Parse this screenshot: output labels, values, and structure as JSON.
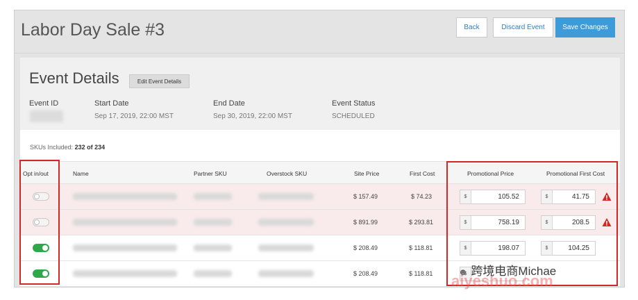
{
  "header": {
    "title": "Labor Day Sale #3",
    "back_label": "Back",
    "discard_label": "Discard Event",
    "save_label": "Save Changes"
  },
  "details": {
    "title": "Event Details",
    "edit_label": "Edit Event Details",
    "event_id_label": "Event ID",
    "start_label": "Start Date",
    "start_value": "Sep 17, 2019, 22:00 MST",
    "end_label": "End Date",
    "end_value": "Sep 30, 2019, 22:00 MST",
    "status_label": "Event Status",
    "status_value": "SCHEDULED"
  },
  "table": {
    "skus_label": "SKUs Included:",
    "skus_value": "232 of 234",
    "columns": [
      "Opt in/out",
      "Name",
      "Partner SKU",
      "Overstock SKU",
      "Site Price",
      "First Cost",
      "Promotional Price",
      "Promotional First Cost"
    ],
    "currency_symbol": "$",
    "rows": [
      {
        "opt_in": false,
        "warning": true,
        "site_price": "$ 157.49",
        "first_cost": "$ 74.23",
        "promo_price": "105.52",
        "promo_first_cost": "41.75"
      },
      {
        "opt_in": false,
        "warning": true,
        "site_price": "$ 891.99",
        "first_cost": "$ 293.81",
        "promo_price": "758.19",
        "promo_first_cost": "208.5"
      },
      {
        "opt_in": true,
        "warning": false,
        "site_price": "$ 208.49",
        "first_cost": "$ 118.81",
        "promo_price": "198.07",
        "promo_first_cost": "104.25"
      },
      {
        "opt_in": true,
        "warning": false,
        "site_price": "$ 208.49",
        "first_cost": "$ 118.81",
        "promo_price": "",
        "promo_first_cost": ""
      }
    ]
  },
  "colors": {
    "accent": "#3d9bd9",
    "toggle_on": "#2fa84a",
    "warning": "#d32626",
    "highlight": "#d32626"
  },
  "watermark": {
    "text": "跨境电商Michae",
    "sub": "aiyeshuo.com"
  }
}
